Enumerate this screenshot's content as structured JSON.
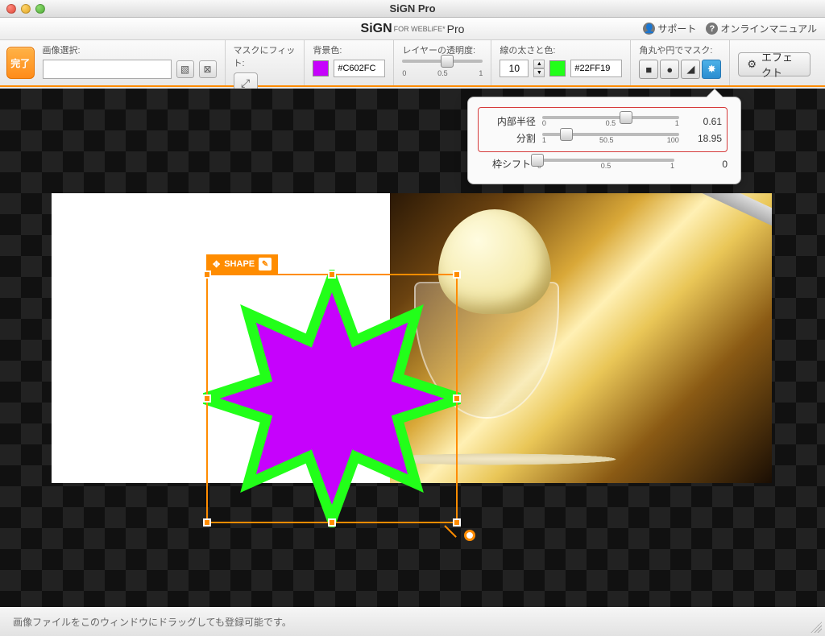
{
  "window": {
    "title": "SiGN Pro"
  },
  "logo": {
    "main": "SiGN",
    "sub": "FOR WEBLiFE*",
    "pro": "Pro"
  },
  "help": {
    "support": "サポート",
    "manual": "オンラインマニュアル"
  },
  "toolbar": {
    "done": "完了",
    "image_select_label": "画像選択:",
    "fit_label": "マスクにフィット:",
    "bg_label": "背景色:",
    "bg_hex": "#C602FC",
    "opacity_label": "レイヤーの透明度:",
    "opacity_min": "0",
    "opacity_mid": "0.5",
    "opacity_max": "1",
    "stroke_label": "線の太さと色:",
    "stroke_width": "10",
    "stroke_hex": "#22FF19",
    "mask_label": "角丸や円でマスク:",
    "effect_btn": "エフェクト"
  },
  "popover": {
    "inner_radius_label": "内部半径",
    "inner_radius_min": "0",
    "inner_radius_mid": "0.5",
    "inner_radius_max": "1",
    "inner_radius_val": "0.61",
    "segments_label": "分割",
    "segments_min": "1",
    "segments_mid": "50.5",
    "segments_max": "100",
    "segments_val": "18.95",
    "shift_label": "枠シフト",
    "shift_min": "0",
    "shift_mid": "0.5",
    "shift_max": "1",
    "shift_val": "0"
  },
  "shape_tab": {
    "move": "✥",
    "label": "SHAPE",
    "edit_icon": "✎"
  },
  "statusbar": {
    "hint": "画像ファイルをこのウィンドウにドラッグしても登録可能です。"
  },
  "colors": {
    "accent": "#ff8c00",
    "bg_fill": "#C602FC",
    "stroke": "#22FF19"
  }
}
